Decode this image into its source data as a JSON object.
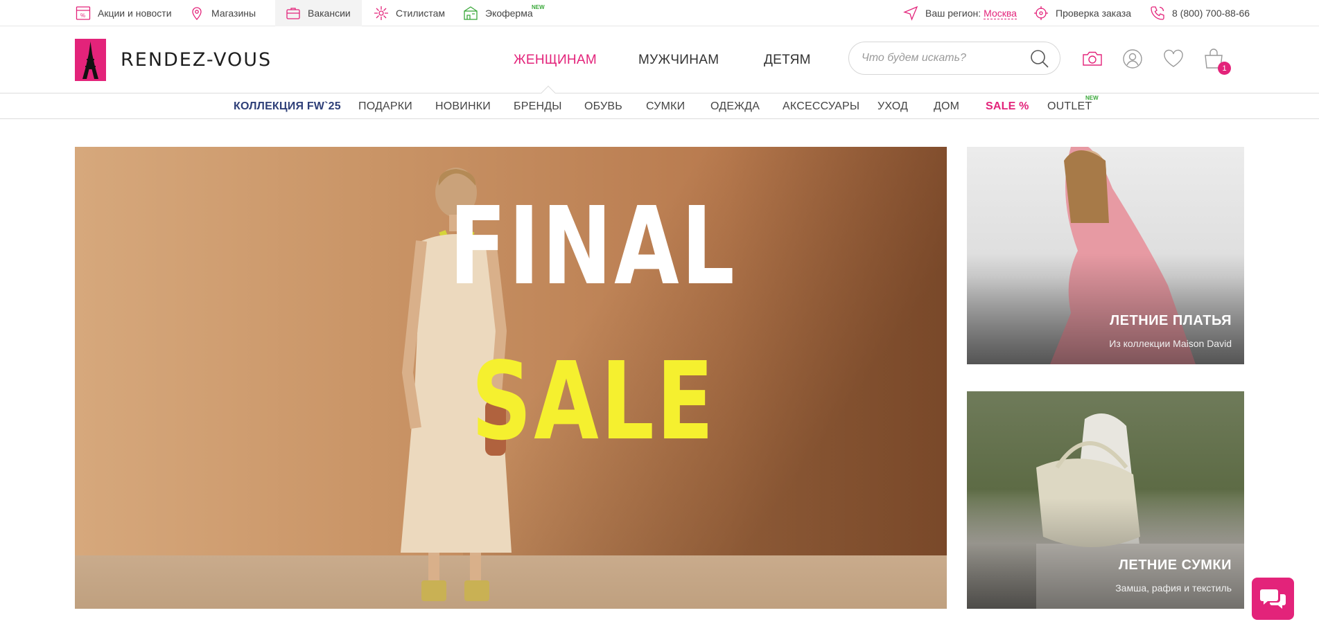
{
  "topbar": {
    "items": [
      {
        "label": "Акции и новости",
        "icon": "percent-tag-icon"
      },
      {
        "label": "Магазины",
        "icon": "map-pin-icon"
      },
      {
        "label": "Вакансии",
        "icon": "briefcase-icon",
        "active": true
      },
      {
        "label": "Стилистам",
        "icon": "sparkle-icon"
      },
      {
        "label": "Экоферма",
        "icon": "eco-farm-icon",
        "badge": "NEW"
      }
    ],
    "region_label": "Ваш регион:",
    "region_value": "Москва",
    "order_check": "Проверка заказа",
    "phone": "8 (800) 700-88-66"
  },
  "header": {
    "logo_text": "RENDEZ-VOUS",
    "nav": [
      {
        "label": "ЖЕНЩИНАМ",
        "active": true
      },
      {
        "label": "МУЖЧИНАМ"
      },
      {
        "label": "ДЕТЯМ"
      }
    ],
    "search_placeholder": "Что будем искать?",
    "cart_count": "1",
    "icons": [
      "camera-icon",
      "user-icon",
      "heart-icon",
      "shopping-bag-icon"
    ]
  },
  "categories": {
    "collection": "КОЛЛЕКЦИЯ FW`25",
    "items": [
      "ПОДАРКИ",
      "НОВИНКИ",
      "БРЕНДЫ",
      "ОБУВЬ",
      "СУМКИ",
      "ОДЕЖДА",
      "АКСЕССУАРЫ",
      "УХОД",
      "ДОМ"
    ],
    "sale": "SALE %",
    "outlet": "OUTLET",
    "outlet_badge": "NEW"
  },
  "hero": {
    "line1": "FINAL",
    "line2": "SALE"
  },
  "side_banners": [
    {
      "title": "ЛЕТНИЕ ПЛАТЬЯ",
      "subtitle": "Из коллекции Maison David"
    },
    {
      "title": "ЛЕТНИЕ СУМКИ",
      "subtitle": "Замша, рафия и текстиль"
    }
  ],
  "colors": {
    "accent": "#e3237a",
    "collection": "#2e3f78",
    "new_badge": "#3aa83a",
    "hero_sale_text": "#f5f02f"
  }
}
